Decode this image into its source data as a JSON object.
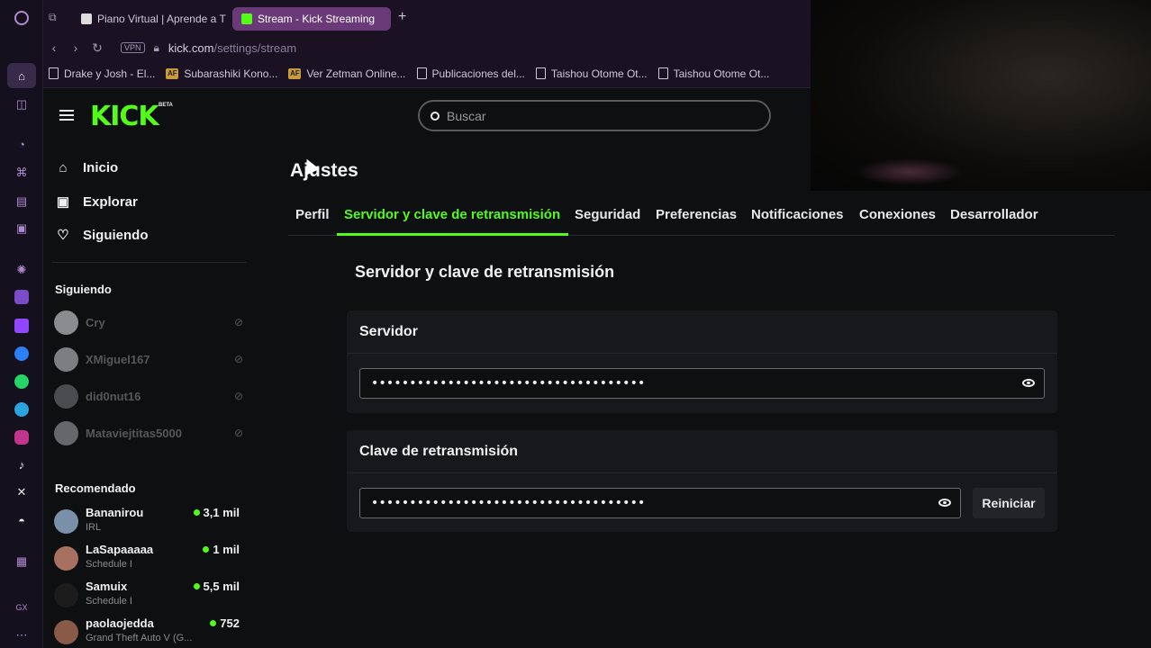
{
  "browser": {
    "tabs": [
      {
        "label": "Piano Virtual | Aprende a T",
        "favicon_color": "#dcdcdc"
      },
      {
        "label": "Stream - Kick Streaming",
        "favicon_color": "#53fc18"
      }
    ],
    "new_tab_label": "+",
    "vpn_label": "VPN",
    "url_host": "kick.com",
    "url_path": "/settings/stream",
    "bookmarks": [
      {
        "label": "Drake y Josh - El..."
      },
      {
        "label": "Subarashiki Kono..."
      },
      {
        "label": "Ver Zetman Online..."
      },
      {
        "label": "Publicaciones del..."
      },
      {
        "label": "Taishou Otome Ot..."
      },
      {
        "label": "Taishou Otome Ot..."
      }
    ]
  },
  "header": {
    "logo": "KICK",
    "logo_badge": "BETA",
    "search_placeholder": "Buscar"
  },
  "sidebar": {
    "nav": [
      {
        "label": "Inicio",
        "icon": "home-icon"
      },
      {
        "label": "Explorar",
        "icon": "explore-icon"
      },
      {
        "label": "Siguiendo",
        "icon": "heart-icon"
      }
    ],
    "following_title": "Siguiendo",
    "following": [
      {
        "name": "Cry"
      },
      {
        "name": "XMiguel167"
      },
      {
        "name": "did0nut16"
      },
      {
        "name": "Mataviejtitas5000"
      }
    ],
    "recommended_title": "Recomendado",
    "recommended": [
      {
        "name": "Bananirou",
        "category": "IRL",
        "viewers": "3,1 mil"
      },
      {
        "name": "LaSapaaaaa",
        "category": "Schedule I",
        "viewers": "1 mil"
      },
      {
        "name": "Samuix",
        "category": "Schedule I",
        "viewers": "5,5 mil"
      },
      {
        "name": "paolaojedda",
        "category": "Grand Theft Auto V (G...",
        "viewers": "752"
      }
    ]
  },
  "main": {
    "page_title": "Ajustes",
    "tabs": [
      {
        "label": "Perfil"
      },
      {
        "label": "Servidor y clave de retransmisión"
      },
      {
        "label": "Seguridad"
      },
      {
        "label": "Preferencias"
      },
      {
        "label": "Notificaciones"
      },
      {
        "label": "Conexiones"
      },
      {
        "label": "Desarrollador"
      }
    ],
    "section_title": "Servidor y clave de retransmisión",
    "server_card": {
      "title": "Servidor",
      "value": "••••••••••••••••••••••••••••••••••••"
    },
    "key_card": {
      "title": "Clave de retransmisión",
      "value": "••••••••••••••••••••••••••••••••••••",
      "reset_label": "Reiniciar"
    }
  },
  "colors": {
    "accent": "#53fc18",
    "background": "#0e0f11",
    "card": "#17181b",
    "browser_chrome": "#1a1222",
    "active_tab": "#6a3a78"
  }
}
